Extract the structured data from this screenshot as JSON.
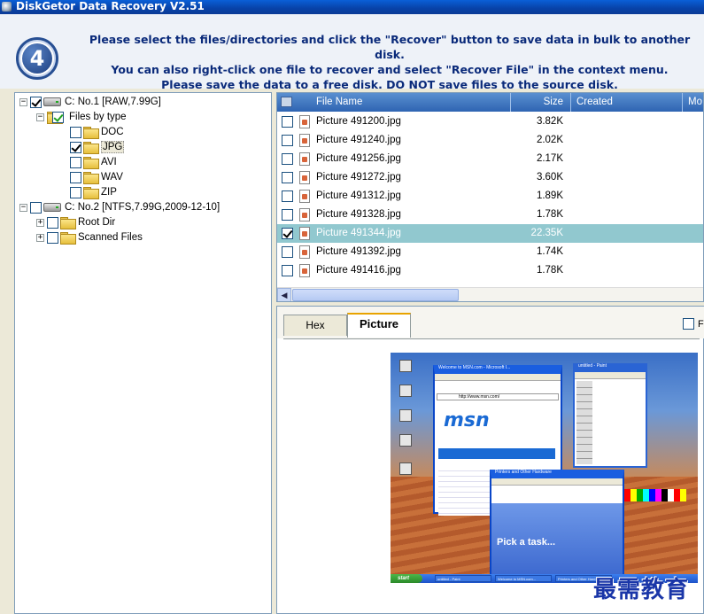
{
  "window": {
    "title": "DiskGetor Data Recovery V2.51"
  },
  "header": {
    "step": "4",
    "lines": [
      "Please select the files/directories and click the \"Recover\" button to save data in bulk to another disk.",
      "You can also right-click one file to recover and select \"Recover File\" in the context menu.",
      "Please save the data to a free disk. DO NOT save files to the source disk."
    ]
  },
  "tree": {
    "disk1": {
      "label": "C: No.1 [RAW,7.99G]",
      "checked": true
    },
    "files_by_type": "Files by type",
    "types": [
      {
        "label": "DOC",
        "checked": false
      },
      {
        "label": "JPG",
        "checked": true
      },
      {
        "label": "AVI",
        "checked": false
      },
      {
        "label": "WAV",
        "checked": false
      },
      {
        "label": "ZIP",
        "checked": false
      }
    ],
    "disk2": {
      "label": "C: No.2 [NTFS,7.99G,2009-12-10]",
      "checked": false
    },
    "disk2_children": [
      "Root Dir",
      "Scanned Files"
    ]
  },
  "file_list": {
    "columns": {
      "name": "File Name",
      "size": "Size",
      "created": "Created",
      "modified": "Mo"
    },
    "rows": [
      {
        "name": "Picture 491200.jpg",
        "size": "3.82K",
        "checked": false,
        "selected": false
      },
      {
        "name": "Picture 491240.jpg",
        "size": "2.02K",
        "checked": false,
        "selected": false
      },
      {
        "name": "Picture 491256.jpg",
        "size": "2.17K",
        "checked": false,
        "selected": false
      },
      {
        "name": "Picture 491272.jpg",
        "size": "3.60K",
        "checked": false,
        "selected": false
      },
      {
        "name": "Picture 491312.jpg",
        "size": "1.89K",
        "checked": false,
        "selected": false
      },
      {
        "name": "Picture 491328.jpg",
        "size": "1.78K",
        "checked": false,
        "selected": false
      },
      {
        "name": "Picture 491344.jpg",
        "size": "22.35K",
        "checked": true,
        "selected": true
      },
      {
        "name": "Picture 491392.jpg",
        "size": "1.74K",
        "checked": false,
        "selected": false
      },
      {
        "name": "Picture 491416.jpg",
        "size": "1.78K",
        "checked": false,
        "selected": false
      }
    ]
  },
  "preview": {
    "tabs": [
      {
        "label": "Hex",
        "active": false
      },
      {
        "label": "Picture",
        "active": true
      }
    ],
    "fit_label": "F",
    "thumbnail": {
      "msn_window_title": "Welcome to MSN.com - Microsoft I...",
      "address": "http://www.msn.com/",
      "msn_logo": "msn",
      "paint_title": "untitled - Paint",
      "explorer_title": "Printers and Other Hardware",
      "pick_task": "Pick a task...",
      "start": "start",
      "taskbar_items": [
        "untitled - Paint",
        "Welcome to MSN.com...",
        "Printers and Other Hard..."
      ]
    }
  },
  "watermark": "最需教育"
}
